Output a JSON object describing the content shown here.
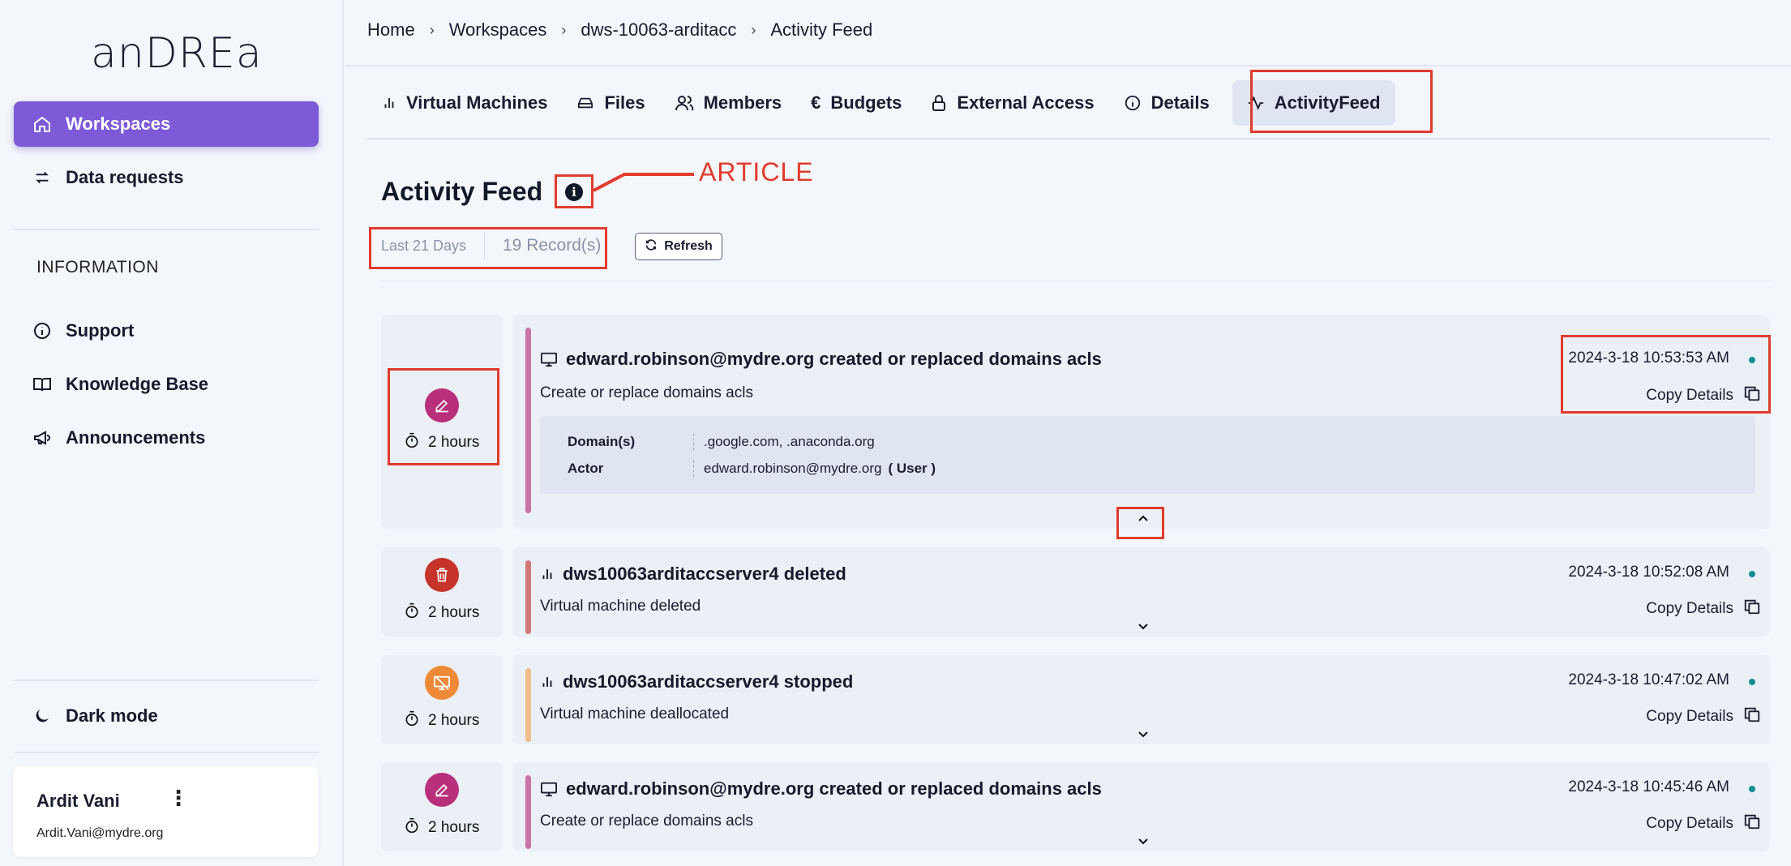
{
  "brand": {
    "logo_text": "anDREa"
  },
  "sidebar": {
    "items": [
      {
        "label": "Workspaces",
        "icon": "home-icon",
        "active": true
      },
      {
        "label": "Data requests",
        "icon": "swap-arrows-icon",
        "active": false
      }
    ],
    "info_heading": "INFORMATION",
    "info_items": [
      {
        "label": "Support",
        "icon": "info-circle-icon"
      },
      {
        "label": "Knowledge Base",
        "icon": "book-icon"
      },
      {
        "label": "Announcements",
        "icon": "megaphone-icon"
      }
    ],
    "dark_mode_label": "Dark mode",
    "user": {
      "name": "Ardit Vani",
      "email": "Ardit.Vani@mydre.org"
    }
  },
  "breadcrumb": [
    "Home",
    "Workspaces",
    "dws-10063-arditacc",
    "Activity Feed"
  ],
  "tabs": [
    {
      "label": "Virtual Machines",
      "icon": "bar-chart-icon"
    },
    {
      "label": "Files",
      "icon": "drive-icon"
    },
    {
      "label": "Members",
      "icon": "users-icon"
    },
    {
      "label": "Budgets",
      "icon": "euro-icon"
    },
    {
      "label": "External Access",
      "icon": "lock-icon"
    },
    {
      "label": "Details",
      "icon": "info-circle-icon"
    },
    {
      "label": "ActivityFeed",
      "icon": "activity-icon",
      "active": true
    }
  ],
  "annotation": {
    "label": "ARTICLE",
    "color": "#e03c2e"
  },
  "page": {
    "title": "Activity Feed",
    "filter_range": "Last 21 Days",
    "record_count": "19 Record(s)",
    "refresh_label": "Refresh"
  },
  "events": [
    {
      "time_ago": "2 hours",
      "badge_icon": "pencil-icon",
      "badge_color": "#b8307a",
      "accent_color": "#c874a6",
      "title_icon": "monitor-icon",
      "title": "edward.robinson@mydre.org created or replaced domains acls",
      "subtitle": "Create or replace domains acls",
      "date": "2024-3-18 10:53:53 AM",
      "copy_label": "Copy Details",
      "expanded": true,
      "details": [
        {
          "key": "Domain(s)",
          "value": ".google.com, .anaconda.org"
        },
        {
          "key": "Actor",
          "value": "edward.robinson@mydre.org",
          "tag": "( User )"
        }
      ]
    },
    {
      "time_ago": "2 hours",
      "badge_icon": "trash-icon",
      "badge_color": "#c6332b",
      "accent_color": "#d07a78",
      "title_icon": "bar-chart-icon",
      "title": "dws10063arditaccserver4 deleted",
      "subtitle": "Virtual machine deleted",
      "date": "2024-3-18 10:52:08 AM",
      "copy_label": "Copy Details",
      "expanded": false
    },
    {
      "time_ago": "2 hours",
      "badge_icon": "monitor-off-icon",
      "badge_color": "#ee8a37",
      "accent_color": "#f0bd8d",
      "title_icon": "bar-chart-icon",
      "title": "dws10063arditaccserver4 stopped",
      "subtitle": "Virtual machine deallocated",
      "date": "2024-3-18 10:47:02 AM",
      "copy_label": "Copy Details",
      "expanded": false
    },
    {
      "time_ago": "2 hours",
      "badge_icon": "pencil-icon",
      "badge_color": "#b8307a",
      "accent_color": "#c874a6",
      "title_icon": "monitor-icon",
      "title": "edward.robinson@mydre.org created or replaced domains acls",
      "subtitle": "Create or replace domains acls",
      "date": "2024-3-18 10:45:46 AM",
      "copy_label": "Copy Details",
      "expanded": false
    }
  ]
}
